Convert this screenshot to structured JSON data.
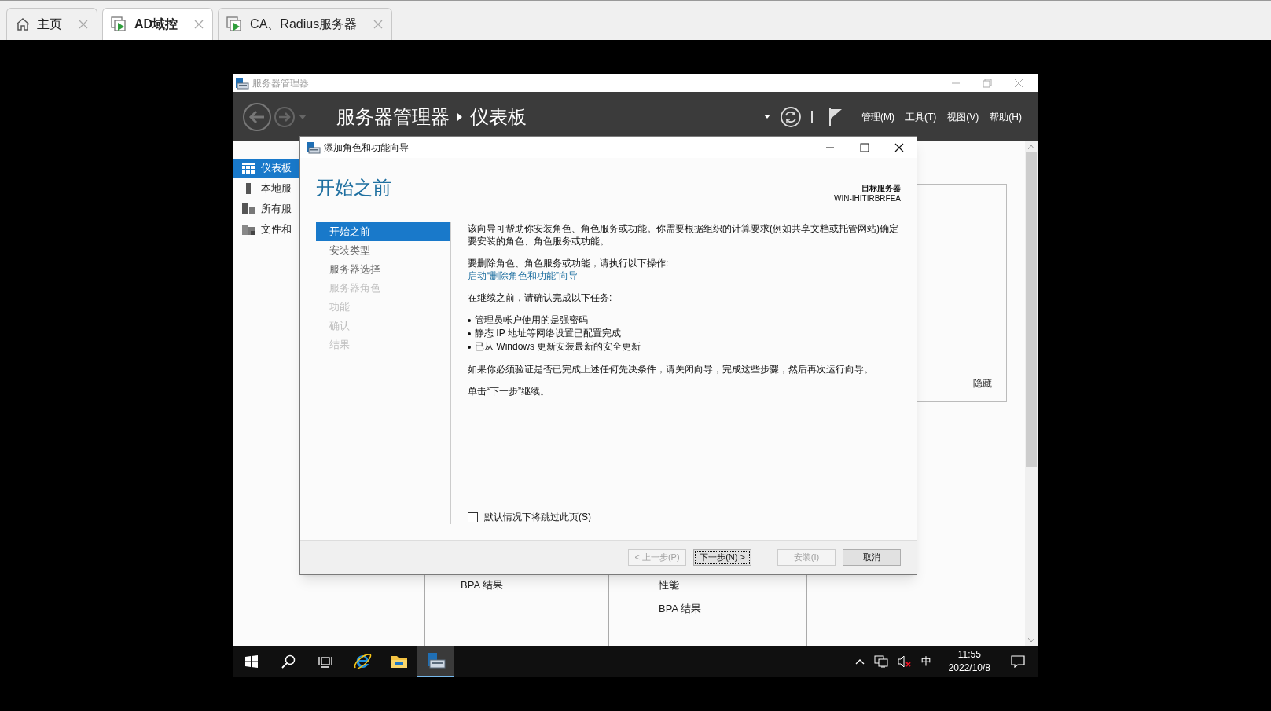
{
  "browser_tabs": [
    {
      "label": "主页",
      "selected": false
    },
    {
      "label": "AD域控",
      "selected": true
    },
    {
      "label": "CA、Radius服务器",
      "selected": false
    }
  ],
  "server_manager": {
    "title": "服务器管理器",
    "breadcrumb": [
      "服务器管理器",
      "仪表板"
    ],
    "menus": [
      "管理(M)",
      "工具(T)",
      "视图(V)",
      "帮助(H)"
    ],
    "sidebar": [
      {
        "label": "仪表板",
        "selected": true
      },
      {
        "label": "本地服",
        "selected": false
      },
      {
        "label": "所有服",
        "selected": false
      },
      {
        "label": "文件和",
        "selected": false
      }
    ],
    "hide_link": "隐藏",
    "tiles": [
      {
        "items": [
          "BPA 结果"
        ]
      },
      {
        "items": [
          "性能",
          "BPA 结果"
        ]
      }
    ]
  },
  "wizard": {
    "title": "添加角色和功能向导",
    "heading": "开始之前",
    "target_label": "目标服务器",
    "target_server": "WIN-IHITIRBRFEA",
    "steps": [
      {
        "label": "开始之前",
        "selected": true,
        "disabled": false
      },
      {
        "label": "安装类型",
        "selected": false,
        "disabled": false
      },
      {
        "label": "服务器选择",
        "selected": false,
        "disabled": false
      },
      {
        "label": "服务器角色",
        "selected": false,
        "disabled": true
      },
      {
        "label": "功能",
        "selected": false,
        "disabled": true
      },
      {
        "label": "确认",
        "selected": false,
        "disabled": true
      },
      {
        "label": "结果",
        "selected": false,
        "disabled": true
      }
    ],
    "content": [
      [
        {
          "kind": "text",
          "text": "该向导可帮助你安装角色、角色服务或功能。你需要根据组织的计算要求(例如共享文档或托管网站)确定要安装的角色、角色服务或功能。"
        }
      ],
      [
        {
          "kind": "text",
          "text": "要删除角色、角色服务或功能，请执行以下操作:"
        },
        {
          "kind": "link",
          "text": "启动“删除角色和功能”向导"
        }
      ],
      [
        {
          "kind": "text",
          "text": "在继续之前，请确认完成以下任务:"
        }
      ],
      [
        {
          "kind": "bullet",
          "text": "管理员帐户使用的是强密码"
        },
        {
          "kind": "bullet",
          "text": "静态 IP 地址等网络设置已配置完成"
        },
        {
          "kind": "bullet",
          "text": "已从 Windows 更新安装最新的安全更新"
        }
      ],
      [
        {
          "kind": "text",
          "text": "如果你必须验证是否已完成上述任何先决条件，请关闭向导，完成这些步骤，然后再次运行向导。"
        }
      ],
      [
        {
          "kind": "text",
          "text": "单击“下一步”继续。"
        }
      ]
    ],
    "skip_checkbox": {
      "label": "默认情况下将跳过此页(S)",
      "checked": false
    },
    "buttons": [
      {
        "label": "< 上一步(P)",
        "disabled": true,
        "focused": false
      },
      {
        "label": "下一步(N) >",
        "disabled": false,
        "focused": true
      },
      {
        "label": "安装(I)",
        "disabled": true,
        "focused": false
      },
      {
        "label": "取消",
        "disabled": false,
        "focused": false
      }
    ]
  },
  "taskbar": {
    "apps": [
      {
        "kind": "ie",
        "active": false
      },
      {
        "kind": "explorer",
        "active": false
      },
      {
        "kind": "server_manager",
        "active": true
      }
    ],
    "ime": "中",
    "time": "11:55",
    "date": "2022/10/8"
  }
}
